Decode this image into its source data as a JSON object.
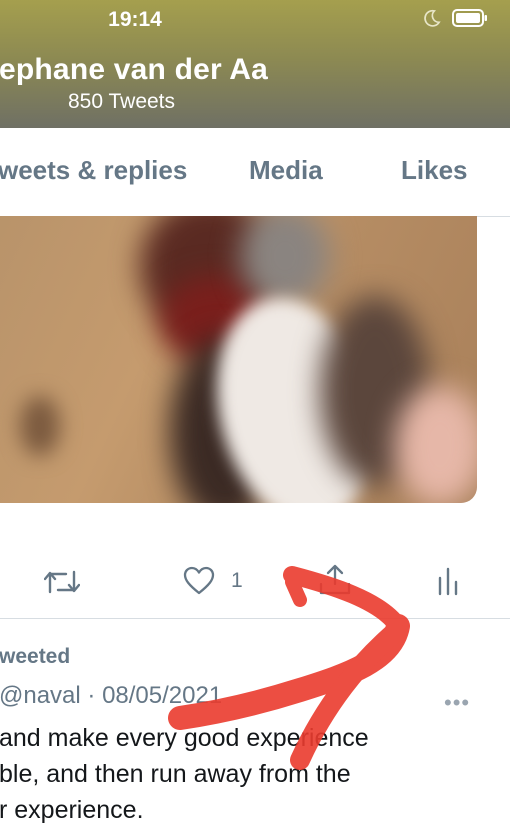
{
  "status_bar": {
    "time": "19:14",
    "icons": [
      "moon-icon",
      "battery-icon"
    ]
  },
  "profile": {
    "name": "ephane van der Aa",
    "tweet_count": "850 Tweets"
  },
  "tabs": [
    {
      "label": "weets & replies"
    },
    {
      "label": "Media"
    },
    {
      "label": "Likes"
    }
  ],
  "tweet_actions": {
    "like_count": "1",
    "icons": [
      "retweet-icon",
      "heart-icon",
      "share-icon",
      "analytics-icon"
    ]
  },
  "next_tweet": {
    "retweeted_label": "weeted",
    "handle_line": "@naval · 08/05/2021",
    "more": "•••",
    "text_lines": [
      "and make every good experience",
      "ble, and then run away from the",
      "r experience."
    ]
  },
  "colors": {
    "header_bg": "#8d8a52",
    "secondary_text": "#657786",
    "annotation_red": "#ea3b2e"
  }
}
